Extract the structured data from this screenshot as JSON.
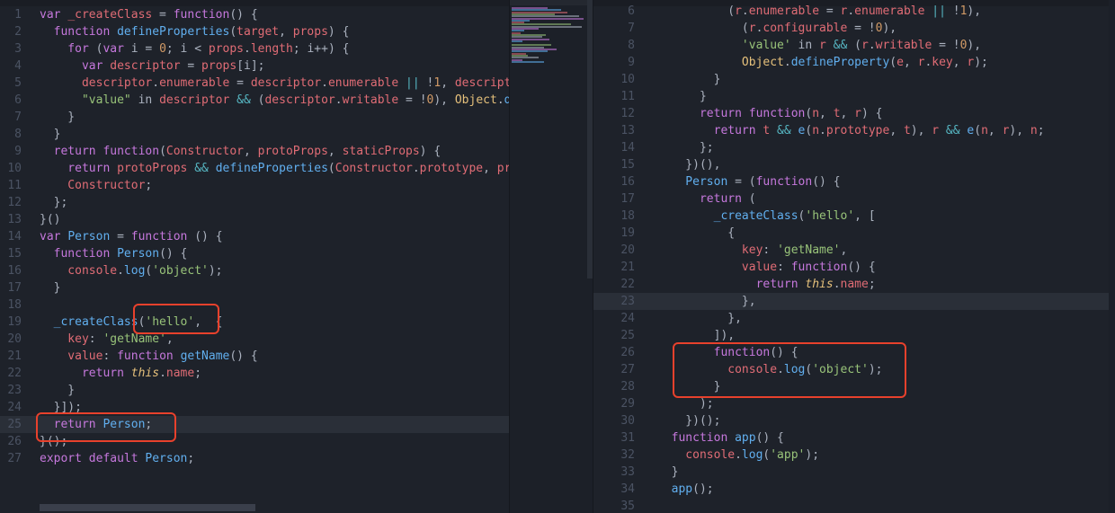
{
  "left_editor": {
    "lines": [
      {
        "n": "1",
        "t": [
          [
            "kw",
            "var "
          ],
          [
            "var",
            "_createClass"
          ],
          [
            "txt",
            " = "
          ],
          [
            "kw",
            "function"
          ],
          [
            "txt",
            "() {"
          ]
        ]
      },
      {
        "n": "2",
        "t": [
          [
            "kw",
            "  function "
          ],
          [
            "fn",
            "defineProperties"
          ],
          [
            "txt",
            "("
          ],
          [
            "var",
            "target"
          ],
          [
            "txt",
            ", "
          ],
          [
            "var",
            "props"
          ],
          [
            "txt",
            ") {"
          ]
        ]
      },
      {
        "n": "3",
        "t": [
          [
            "kw",
            "    for "
          ],
          [
            "txt",
            "("
          ],
          [
            "kw",
            "var "
          ],
          [
            "txt",
            "i = "
          ],
          [
            "num",
            "0"
          ],
          [
            "txt",
            "; i < "
          ],
          [
            "var",
            "props"
          ],
          [
            "txt",
            "."
          ],
          [
            "var",
            "length"
          ],
          [
            "txt",
            "; i++) {"
          ]
        ]
      },
      {
        "n": "4",
        "t": [
          [
            "kw",
            "      var "
          ],
          [
            "var",
            "descriptor"
          ],
          [
            "txt",
            " = "
          ],
          [
            "var",
            "props"
          ],
          [
            "txt",
            "[i];"
          ]
        ]
      },
      {
        "n": "5",
        "t": [
          [
            "var",
            "      descriptor"
          ],
          [
            "txt",
            "."
          ],
          [
            "var",
            "enumerable"
          ],
          [
            "txt",
            " = "
          ],
          [
            "var",
            "descriptor"
          ],
          [
            "txt",
            "."
          ],
          [
            "var",
            "enumerable"
          ],
          [
            "op",
            " || "
          ],
          [
            "txt",
            "!"
          ],
          [
            "num",
            "1"
          ],
          [
            "txt",
            ", "
          ],
          [
            "var",
            "descriptor"
          ],
          [
            "txt",
            "."
          ]
        ]
      },
      {
        "n": "6",
        "t": [
          [
            "str",
            "      \"value\""
          ],
          [
            "txt",
            " in "
          ],
          [
            "var",
            "descriptor"
          ],
          [
            "op",
            " && "
          ],
          [
            "txt",
            "("
          ],
          [
            "var",
            "descriptor"
          ],
          [
            "txt",
            "."
          ],
          [
            "var",
            "writable"
          ],
          [
            "txt",
            " = !"
          ],
          [
            "num",
            "0"
          ],
          [
            "txt",
            "), "
          ],
          [
            "yl",
            "Object"
          ],
          [
            "txt",
            "."
          ],
          [
            "fn",
            "defi"
          ]
        ]
      },
      {
        "n": "7",
        "t": [
          [
            "txt",
            "    }"
          ]
        ]
      },
      {
        "n": "8",
        "t": [
          [
            "txt",
            "  }"
          ]
        ]
      },
      {
        "n": "9",
        "t": [
          [
            "kw",
            "  return function"
          ],
          [
            "txt",
            "("
          ],
          [
            "var",
            "Constructor"
          ],
          [
            "txt",
            ", "
          ],
          [
            "var",
            "protoProps"
          ],
          [
            "txt",
            ", "
          ],
          [
            "var",
            "staticProps"
          ],
          [
            "txt",
            ") {"
          ]
        ]
      },
      {
        "n": "10",
        "t": [
          [
            "kw",
            "    return "
          ],
          [
            "var",
            "protoProps"
          ],
          [
            "op",
            " && "
          ],
          [
            "fn",
            "defineProperties"
          ],
          [
            "txt",
            "("
          ],
          [
            "var",
            "Constructor"
          ],
          [
            "txt",
            "."
          ],
          [
            "var",
            "prototype"
          ],
          [
            "txt",
            ", "
          ],
          [
            "var",
            "proto"
          ]
        ]
      },
      {
        "n": "11",
        "t": [
          [
            "var",
            "    Constructor"
          ],
          [
            "txt",
            ";"
          ]
        ]
      },
      {
        "n": "12",
        "t": [
          [
            "txt",
            "  };"
          ]
        ]
      },
      {
        "n": "13",
        "t": [
          [
            "txt",
            "}()"
          ]
        ]
      },
      {
        "n": "14",
        "t": [
          [
            "kw",
            "var "
          ],
          [
            "fn",
            "Person"
          ],
          [
            "txt",
            " = "
          ],
          [
            "kw",
            "function"
          ],
          [
            "txt",
            " () {"
          ]
        ]
      },
      {
        "n": "15",
        "t": [
          [
            "kw",
            "  function "
          ],
          [
            "fn",
            "Person"
          ],
          [
            "txt",
            "() {"
          ]
        ]
      },
      {
        "n": "16",
        "t": [
          [
            "var",
            "    console"
          ],
          [
            "txt",
            "."
          ],
          [
            "fn",
            "log"
          ],
          [
            "txt",
            "("
          ],
          [
            "str",
            "'object'"
          ],
          [
            "txt",
            ");"
          ]
        ]
      },
      {
        "n": "17",
        "t": [
          [
            "txt",
            "  }"
          ]
        ]
      },
      {
        "n": "18",
        "t": []
      },
      {
        "n": "19",
        "t": [
          [
            "fn",
            "  _createClass"
          ],
          [
            "txt",
            "("
          ],
          [
            "str",
            "'hello'"
          ],
          [
            "txt",
            ",  {"
          ]
        ]
      },
      {
        "n": "20",
        "t": [
          [
            "var",
            "    key"
          ],
          [
            "txt",
            ": "
          ],
          [
            "str",
            "'getName'"
          ],
          [
            "txt",
            ","
          ]
        ]
      },
      {
        "n": "21",
        "t": [
          [
            "var",
            "    value"
          ],
          [
            "txt",
            ": "
          ],
          [
            "kw",
            "function "
          ],
          [
            "fn",
            "getName"
          ],
          [
            "txt",
            "() {"
          ]
        ]
      },
      {
        "n": "22",
        "t": [
          [
            "kw",
            "      return "
          ],
          [
            "it",
            "this"
          ],
          [
            "txt",
            "."
          ],
          [
            "var",
            "name"
          ],
          [
            "txt",
            ";"
          ]
        ]
      },
      {
        "n": "23",
        "t": [
          [
            "txt",
            "    }"
          ]
        ]
      },
      {
        "n": "24",
        "t": [
          [
            "txt",
            "  }]);"
          ]
        ]
      },
      {
        "n": "25",
        "t": [
          [
            "kw",
            "  return "
          ],
          [
            "fn",
            "Person"
          ],
          [
            "txt",
            ";"
          ]
        ]
      },
      {
        "n": "26",
        "t": [
          [
            "txt",
            "}();"
          ]
        ]
      },
      {
        "n": "27",
        "t": [
          [
            "kw",
            "export default "
          ],
          [
            "fn",
            "Person"
          ],
          [
            "txt",
            ";"
          ]
        ]
      }
    ]
  },
  "right_editor": {
    "lines": [
      {
        "n": "6",
        "t": [
          [
            "txt",
            "          ("
          ],
          [
            "var",
            "r"
          ],
          [
            "txt",
            "."
          ],
          [
            "var",
            "enumerable"
          ],
          [
            "txt",
            " = "
          ],
          [
            "var",
            "r"
          ],
          [
            "txt",
            "."
          ],
          [
            "var",
            "enumerable"
          ],
          [
            "op",
            " || "
          ],
          [
            "txt",
            "!"
          ],
          [
            "num",
            "1"
          ],
          [
            "txt",
            "),"
          ]
        ]
      },
      {
        "n": "7",
        "t": [
          [
            "txt",
            "            ("
          ],
          [
            "var",
            "r"
          ],
          [
            "txt",
            "."
          ],
          [
            "var",
            "configurable"
          ],
          [
            "txt",
            " = !"
          ],
          [
            "num",
            "0"
          ],
          [
            "txt",
            "),"
          ]
        ]
      },
      {
        "n": "8",
        "t": [
          [
            "str",
            "            'value'"
          ],
          [
            "txt",
            " in "
          ],
          [
            "var",
            "r"
          ],
          [
            "op",
            " && "
          ],
          [
            "txt",
            "("
          ],
          [
            "var",
            "r"
          ],
          [
            "txt",
            "."
          ],
          [
            "var",
            "writable"
          ],
          [
            "txt",
            " = !"
          ],
          [
            "num",
            "0"
          ],
          [
            "txt",
            "),"
          ]
        ]
      },
      {
        "n": "9",
        "t": [
          [
            "yl",
            "            Object"
          ],
          [
            "txt",
            "."
          ],
          [
            "fn",
            "defineProperty"
          ],
          [
            "txt",
            "("
          ],
          [
            "var",
            "e"
          ],
          [
            "txt",
            ", "
          ],
          [
            "var",
            "r"
          ],
          [
            "txt",
            "."
          ],
          [
            "var",
            "key"
          ],
          [
            "txt",
            ", "
          ],
          [
            "var",
            "r"
          ],
          [
            "txt",
            ");"
          ]
        ]
      },
      {
        "n": "10",
        "t": [
          [
            "txt",
            "        }"
          ]
        ]
      },
      {
        "n": "11",
        "t": [
          [
            "txt",
            "      }"
          ]
        ]
      },
      {
        "n": "12",
        "t": [
          [
            "kw",
            "      return function"
          ],
          [
            "txt",
            "("
          ],
          [
            "var",
            "n"
          ],
          [
            "txt",
            ", "
          ],
          [
            "var",
            "t"
          ],
          [
            "txt",
            ", "
          ],
          [
            "var",
            "r"
          ],
          [
            "txt",
            ") {"
          ]
        ]
      },
      {
        "n": "13",
        "t": [
          [
            "kw",
            "        return "
          ],
          [
            "var",
            "t"
          ],
          [
            "op",
            " && "
          ],
          [
            "fn",
            "e"
          ],
          [
            "txt",
            "("
          ],
          [
            "var",
            "n"
          ],
          [
            "txt",
            "."
          ],
          [
            "var",
            "prototype"
          ],
          [
            "txt",
            ", "
          ],
          [
            "var",
            "t"
          ],
          [
            "txt",
            "), "
          ],
          [
            "var",
            "r"
          ],
          [
            "op",
            " && "
          ],
          [
            "fn",
            "e"
          ],
          [
            "txt",
            "("
          ],
          [
            "var",
            "n"
          ],
          [
            "txt",
            ", "
          ],
          [
            "var",
            "r"
          ],
          [
            "txt",
            "), "
          ],
          [
            "var",
            "n"
          ],
          [
            "txt",
            ";"
          ]
        ]
      },
      {
        "n": "14",
        "t": [
          [
            "txt",
            "      };"
          ]
        ]
      },
      {
        "n": "15",
        "t": [
          [
            "txt",
            "    })(),"
          ]
        ]
      },
      {
        "n": "16",
        "t": [
          [
            "fn",
            "    Person"
          ],
          [
            "txt",
            " = ("
          ],
          [
            "kw",
            "function"
          ],
          [
            "txt",
            "() {"
          ]
        ]
      },
      {
        "n": "17",
        "t": [
          [
            "kw",
            "      return "
          ],
          [
            "txt",
            "("
          ]
        ]
      },
      {
        "n": "18",
        "t": [
          [
            "fn",
            "        _createClass"
          ],
          [
            "txt",
            "("
          ],
          [
            "str",
            "'hello'"
          ],
          [
            "txt",
            ", ["
          ]
        ]
      },
      {
        "n": "19",
        "t": [
          [
            "txt",
            "          {"
          ]
        ]
      },
      {
        "n": "20",
        "t": [
          [
            "var",
            "            key"
          ],
          [
            "txt",
            ": "
          ],
          [
            "str",
            "'getName'"
          ],
          [
            "txt",
            ","
          ]
        ]
      },
      {
        "n": "21",
        "t": [
          [
            "var",
            "            value"
          ],
          [
            "txt",
            ": "
          ],
          [
            "kw",
            "function"
          ],
          [
            "txt",
            "() {"
          ]
        ]
      },
      {
        "n": "22",
        "t": [
          [
            "kw",
            "              return "
          ],
          [
            "it",
            "this"
          ],
          [
            "txt",
            "."
          ],
          [
            "var",
            "name"
          ],
          [
            "txt",
            ";"
          ]
        ]
      },
      {
        "n": "23",
        "t": [
          [
            "txt",
            "            },"
          ]
        ]
      },
      {
        "n": "24",
        "t": [
          [
            "txt",
            "          },"
          ]
        ]
      },
      {
        "n": "25",
        "t": [
          [
            "txt",
            "        ]),"
          ]
        ]
      },
      {
        "n": "26",
        "t": [
          [
            "kw",
            "        function"
          ],
          [
            "txt",
            "() {"
          ]
        ]
      },
      {
        "n": "27",
        "t": [
          [
            "var",
            "          console"
          ],
          [
            "txt",
            "."
          ],
          [
            "fn",
            "log"
          ],
          [
            "txt",
            "("
          ],
          [
            "str",
            "'object'"
          ],
          [
            "txt",
            ");"
          ]
        ]
      },
      {
        "n": "28",
        "t": [
          [
            "txt",
            "        }"
          ]
        ]
      },
      {
        "n": "29",
        "t": [
          [
            "txt",
            "      );"
          ]
        ]
      },
      {
        "n": "30",
        "t": [
          [
            "txt",
            "    })();"
          ]
        ]
      },
      {
        "n": "31",
        "t": [
          [
            "kw",
            "  function "
          ],
          [
            "fn",
            "app"
          ],
          [
            "txt",
            "() {"
          ]
        ]
      },
      {
        "n": "32",
        "t": [
          [
            "var",
            "    console"
          ],
          [
            "txt",
            "."
          ],
          [
            "fn",
            "log"
          ],
          [
            "txt",
            "("
          ],
          [
            "str",
            "'app'"
          ],
          [
            "txt",
            ");"
          ]
        ]
      },
      {
        "n": "33",
        "t": [
          [
            "txt",
            "  }"
          ]
        ]
      },
      {
        "n": "34",
        "t": [
          [
            "fn",
            "  app"
          ],
          [
            "txt",
            "();"
          ]
        ]
      },
      {
        "n": "35",
        "t": []
      }
    ]
  }
}
